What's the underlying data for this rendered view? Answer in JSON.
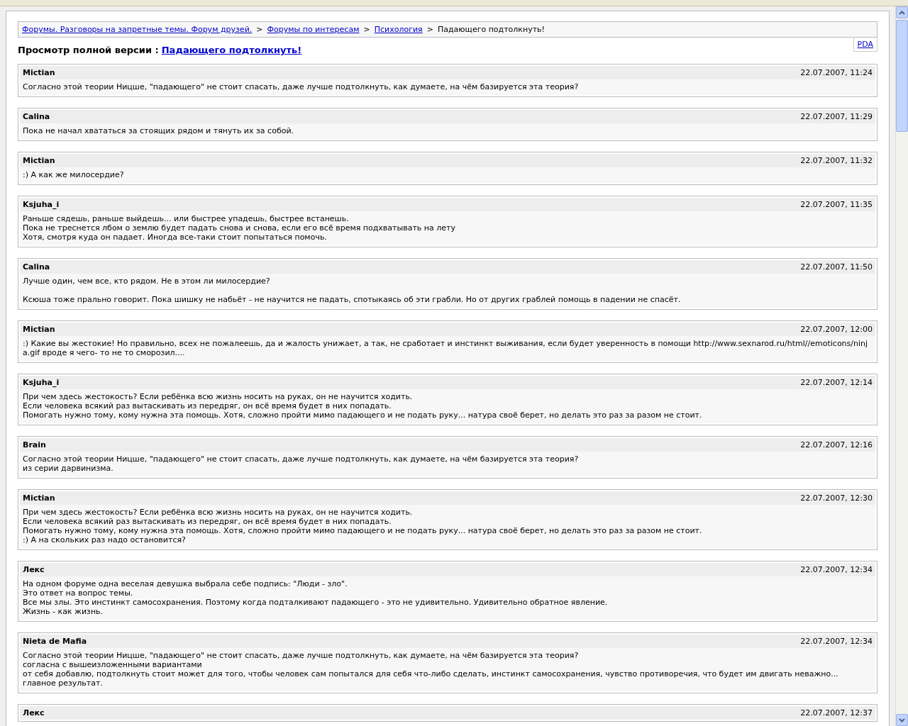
{
  "breadcrumb": {
    "links": [
      "Форумы. Разговоры на запретные темы. Форум друзей.",
      "Форумы по интересам",
      "Психология"
    ],
    "separator": ">",
    "current": "Падающего подтолкнуть!"
  },
  "pda_link": "PDA",
  "heading": {
    "label": "Просмотр полной версии :",
    "link": "Падающего подтолкнуть!"
  },
  "posts": [
    {
      "author": "Mictian",
      "date": "22.07.2007, 11:24",
      "paragraphs": [
        [
          "Согласно этой теории Ницше, \"падающего\" не стоит спасать, даже лучше подтолкнуть, как думаете, на чём базируется эта теория?"
        ]
      ]
    },
    {
      "author": "Calina",
      "date": "22.07.2007, 11:29",
      "paragraphs": [
        [
          "Пока не начал хвататься за стоящих рядом и тянуть их за собой."
        ]
      ]
    },
    {
      "author": "Mictian",
      "date": "22.07.2007, 11:32",
      "paragraphs": [
        [
          ":) А как же милосердие?"
        ]
      ]
    },
    {
      "author": "Ksjuha_i",
      "date": "22.07.2007, 11:35",
      "paragraphs": [
        [
          "Раньше сядешь, раньше выйдешь... или быстрее упадешь, быстрее встанешь.",
          "Пока не треснется лбом о землю будет падать снова и снова, если его всё время подхватывать на лету",
          "Хотя, смотря куда он падает. Иногда все-таки стоит попытаться помочь."
        ]
      ]
    },
    {
      "author": "Calina",
      "date": "22.07.2007, 11:50",
      "paragraphs": [
        [
          "Лучше один, чем все, кто рядом. Не в этом ли милосердие?"
        ],
        [
          "Ксюша тоже прально говорит. Пока шишку не набьёт - не научится не падать, спотыкаясь об эти грабли. Но от других граблей помощь в падении не спасёт."
        ]
      ]
    },
    {
      "author": "Mictian",
      "date": "22.07.2007, 12:00",
      "paragraphs": [
        [
          ":) Какие вы жестокие! Но правильно, всех не пожалеешь, да и жалость унижает, а так, не сработает и инстинкт выживания, если будет уверенность в помощи http://www.sexnarod.ru/html//emoticons/ninja.gif вроде я чего- то не то сморозил...."
        ]
      ]
    },
    {
      "author": "Ksjuha_i",
      "date": "22.07.2007, 12:14",
      "paragraphs": [
        [
          "При чем здесь жестокость? Если ребёнка всю жизнь носить на руках, он не научится ходить.",
          "Если человека всякий раз вытаскивать из передряг, он всё время будет в них попадать.",
          "Помогать нужно тому, кому нужна эта помощь. Хотя, сложно пройти мимо падающего и не подать руку... натура своё берет, но делать это раз за разом не стоит."
        ]
      ]
    },
    {
      "author": "Brain",
      "date": "22.07.2007, 12:16",
      "paragraphs": [
        [
          "Согласно этой теории Ницше, \"падающего\" не стоит спасать, даже лучше подтолкнуть, как думаете, на чём базируется эта теория?",
          "из серии дарвинизма."
        ]
      ]
    },
    {
      "author": "Mictian",
      "date": "22.07.2007, 12:30",
      "paragraphs": [
        [
          "При чем здесь жестокость? Если ребёнка всю жизнь носить на руках, он не научится ходить.",
          "Если человека всякий раз вытаскивать из передряг, он всё время будет в них попадать.",
          "Помогать нужно тому, кому нужна эта помощь. Хотя, сложно пройти мимо падающего и не подать руку... натура своё берет, но делать это раз за разом не стоит.",
          ":) А на скольких раз надо остановится?"
        ]
      ]
    },
    {
      "author": "Лекс",
      "date": "22.07.2007, 12:34",
      "paragraphs": [
        [
          "На одном форуме одна веселая девушка выбрала себе подпись: \"Люди - зло\".",
          "Это ответ на вопрос темы.",
          "Все мы злы. Это инстинкт самосохранения. Поэтому когда подталкивают падающего - это не удивительно. Удивительно обратное явление.",
          "Жизнь - как жизнь."
        ]
      ]
    },
    {
      "author": "Nieta de Mafia",
      "date": "22.07.2007, 12:34",
      "paragraphs": [
        [
          "Согласно этой теории Ницше, \"падающего\" не стоит спасать, даже лучше подтолкнуть, как думаете, на чём базируется эта теория?",
          "согласна с вышеизложенными вариантами",
          "от себя добавлю, подтолкнуть стоит может для того, чтобы человек сам попытался для себя что-либо сделать, инстинкт самосохранения, чувство противоречия, что будет им двигать неважно...",
          "главное результат."
        ]
      ]
    },
    {
      "author": "Лекс",
      "date": "22.07.2007, 12:37"
    }
  ]
}
